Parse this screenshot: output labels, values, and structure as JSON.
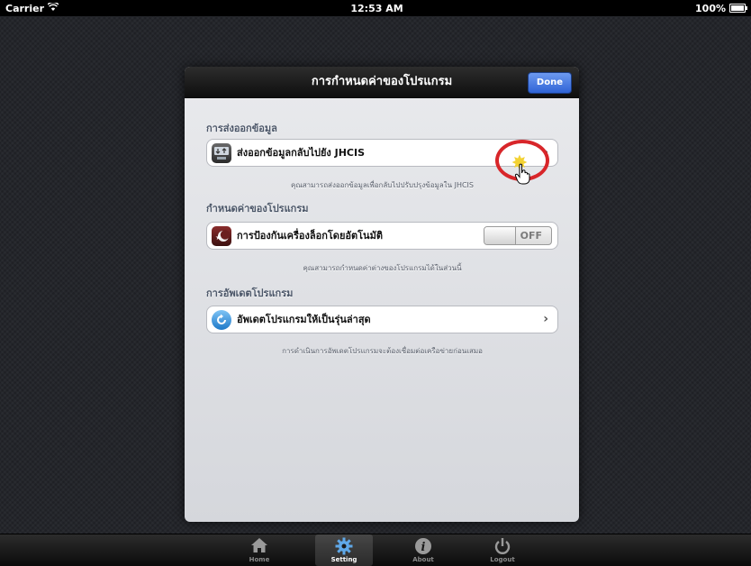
{
  "status_bar": {
    "carrier": "Carrier",
    "time": "12:53 AM",
    "battery": "100%"
  },
  "modal": {
    "title": "การกำหนดค่าของโปรแกรม",
    "done_label": "Done",
    "sections": [
      {
        "header": "การส่งออกข้อมูล",
        "cell_label": "ส่งออกข้อมูลกลับไปยัง JHCIS",
        "footer": "คุณสามารถส่งออกข้อมูลเพื่อกลับไปปรับปรุงข้อมูลใน JHCIS"
      },
      {
        "header": "กำหนดค่าของโปรแกรม",
        "cell_label": "การป้องกันเครื่องล็อกโดยอัตโนมัติ",
        "toggle_state": "OFF",
        "footer": "คุณสามารถกำหนดค่าต่างของโปรแกรมได้ในส่วนนี้"
      },
      {
        "header": "การอัพเดตโปรแกรม",
        "cell_label": "อัพเดตโปรแกรมให้เป็นรุ่นล่าสุด",
        "footer": "การดำเนินการอัพเดตโปรแกรมจะต้องเชื่อมต่อเครือข่ายก่อนเสมอ"
      }
    ]
  },
  "tab_bar": {
    "items": [
      {
        "label": "Home",
        "icon": "home-icon"
      },
      {
        "label": "Setting",
        "icon": "gear-icon",
        "active": true
      },
      {
        "label": "About",
        "icon": "info-icon"
      },
      {
        "label": "Logout",
        "icon": "power-icon"
      }
    ]
  },
  "colors": {
    "done_button": "#2f63d6",
    "highlight_circle": "#d8262a",
    "header_bar": "#111111"
  }
}
